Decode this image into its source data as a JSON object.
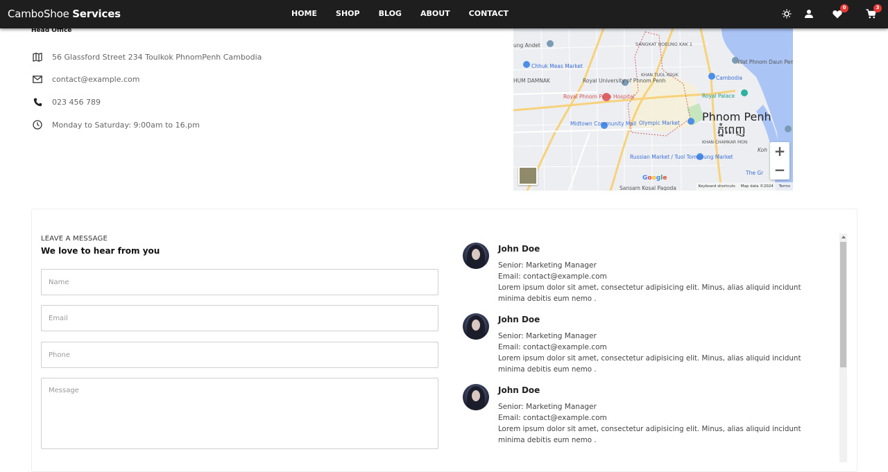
{
  "navbar": {
    "brand_light": "CamboShoe",
    "brand_bold": "Services",
    "links": [
      "HOME",
      "SHOP",
      "BLOG",
      "ABOUT",
      "CONTACT"
    ],
    "wishlist_count": "0",
    "cart_count": "3",
    "icons": [
      "theme-toggle-icon",
      "user-icon",
      "heart-icon",
      "cart-icon"
    ]
  },
  "contact_info": {
    "heading": "Head Office",
    "address": "56 Glassford Street 234 Toulkok PhnomPenh Cambodia",
    "email": "contact@example.com",
    "phone": "023 456 789",
    "hours": "Monday to Saturday: 9:00am to 16.pm"
  },
  "map": {
    "city_en": "Phnom Penh",
    "city_km": "ភ្នំពេញ",
    "places": [
      "Chhuk Meas Market",
      "Royal University of Phnom Penh",
      "Royal Phnom Penh Hospital",
      "Midtown Community Mall",
      "Olympic Market",
      "Russian Market / Tuol Tompoung Market",
      "Royal Palace",
      "Wat Phnom Daun Pen",
      "Cambodia",
      "Sansam Kosal Pagoda",
      "The Gr",
      "Koh"
    ],
    "districts": [
      "SANGKAT BOEUNG KAK 1",
      "KHAN TUOL KOUK",
      "TUOL SANGKE",
      "KHAN CHAMKAR MON",
      "HUM DAMNAK",
      "ung Andet"
    ],
    "footer": [
      "Keyboard shortcuts",
      "Map data ©2024",
      "Terms"
    ],
    "google": "Google",
    "zoom_in": "+",
    "zoom_out": "−"
  },
  "form": {
    "label": "LEAVE A MESSAGE",
    "title": "We love to hear from you",
    "name_placeholder": "Name",
    "email_placeholder": "Email",
    "phone_placeholder": "Phone",
    "message_placeholder": "Message"
  },
  "testimonials": [
    {
      "name": "John Doe",
      "role": "Senior: Marketing Manager",
      "email": "Email: contact@example.com",
      "text": "Lorem ipsum dolor sit amet, consectetur adipisicing elit. Minus, alias aliquid incidunt minima debitis eum nemo ."
    },
    {
      "name": "John Doe",
      "role": "Senior: Marketing Manager",
      "email": "Email: contact@example.com",
      "text": "Lorem ipsum dolor sit amet, consectetur adipisicing elit. Minus, alias aliquid incidunt minima debitis eum nemo ."
    },
    {
      "name": "John Doe",
      "role": "Senior: Marketing Manager",
      "email": "Email: contact@example.com",
      "text": "Lorem ipsum dolor sit amet, consectetur adipisicing elit. Minus, alias aliquid incidunt minima debitis eum nemo ."
    }
  ],
  "colors": {
    "navbar_bg": "#1e1e1e",
    "badge": "#e53935",
    "map_water": "#aac4f5",
    "map_road": "#f7d27a"
  }
}
